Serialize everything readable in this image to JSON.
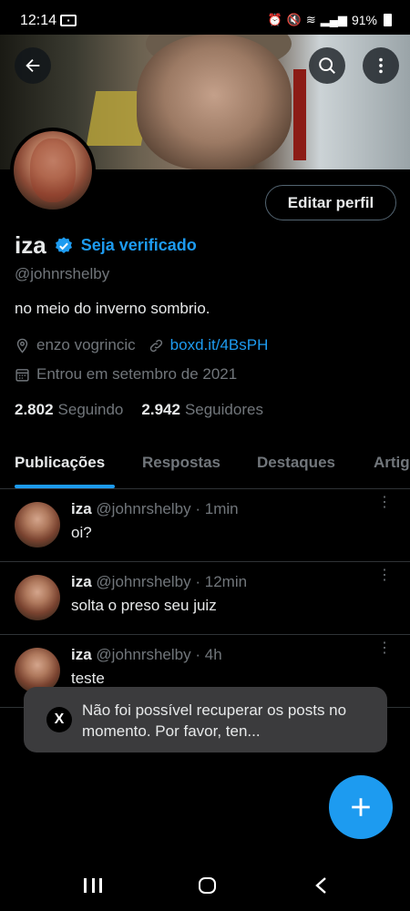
{
  "status_bar": {
    "time": "12:14",
    "battery": "91%"
  },
  "profile": {
    "display_name": "iza",
    "get_verified_label": "Seja verificado",
    "handle": "@johnrshelby",
    "bio": "no meio do inverno sombrio.",
    "location": "enzo vogrincic",
    "link": "boxd.it/4BsPH",
    "joined": "Entrou em setembro de 2021",
    "following_count": "2.802",
    "following_label": "Seguindo",
    "followers_count": "2.942",
    "followers_label": "Seguidores",
    "edit_button_label": "Editar perfil"
  },
  "tabs": [
    {
      "label": "Publicações",
      "active": true
    },
    {
      "label": "Respostas",
      "active": false
    },
    {
      "label": "Destaques",
      "active": false
    },
    {
      "label": "Artig",
      "active": false
    }
  ],
  "posts": [
    {
      "name": "iza",
      "handle": "@johnrshelby",
      "time": "· 1min",
      "text": "oi?"
    },
    {
      "name": "iza",
      "handle": "@johnrshelby",
      "time": "· 12min",
      "text": "solta o preso seu juiz"
    },
    {
      "name": "iza",
      "handle": "@johnrshelby",
      "time": "· 4h",
      "text": "teste"
    }
  ],
  "toast": {
    "icon_text": "X",
    "message": "Não foi possível recuperar os posts no momento. Por favor, ten..."
  },
  "colors": {
    "accent": "#1d9bf0",
    "background": "#000000",
    "muted_text": "#71767b",
    "toast_bg": "#3b3b3d"
  },
  "icons": [
    "back-arrow-icon",
    "search-icon",
    "more-vertical-icon",
    "verified-badge-icon",
    "location-pin-icon",
    "link-icon",
    "calendar-icon",
    "x-logo-icon",
    "plus-icon"
  ]
}
